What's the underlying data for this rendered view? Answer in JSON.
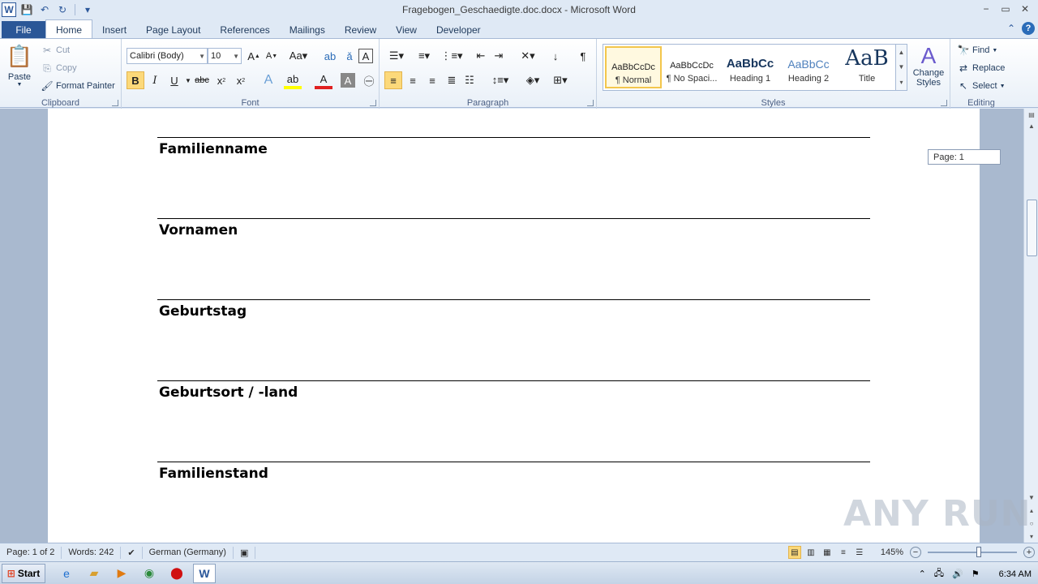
{
  "window": {
    "title": "Fragebogen_Geschaedigte.doc.docx - Microsoft Word",
    "controls": [
      "−",
      "▭",
      "✕"
    ]
  },
  "qat": {
    "app_icon": "W",
    "save": "💾",
    "undo": "↶",
    "redo": "↻",
    "customize": "▾"
  },
  "tabs": [
    "File",
    "Home",
    "Insert",
    "Page Layout",
    "References",
    "Mailings",
    "Review",
    "View",
    "Developer"
  ],
  "ribbon": {
    "clipboard": {
      "label": "Clipboard",
      "paste": "Paste",
      "cut": "Cut",
      "copy": "Copy",
      "format_painter": "Format Painter"
    },
    "font": {
      "label": "Font",
      "font_name": "Calibri (Body)",
      "font_size": "10"
    },
    "paragraph": {
      "label": "Paragraph"
    },
    "styles": {
      "label": "Styles",
      "items": [
        {
          "sample": "AaBbCcDc",
          "name": "¶ Normal"
        },
        {
          "sample": "AaBbCcDc",
          "name": "¶ No Spaci..."
        },
        {
          "sample": "AaBbCc",
          "name": "Heading 1"
        },
        {
          "sample": "AaBbCc",
          "name": "Heading 2"
        },
        {
          "sample": "AaB",
          "name": "Title"
        }
      ],
      "change_styles": "Change Styles"
    },
    "editing": {
      "label": "Editing",
      "find": "Find",
      "replace": "Replace",
      "select": "Select"
    }
  },
  "document": {
    "fields": [
      "Familienname",
      "Vornamen",
      "Geburtstag",
      "Geburtsort  / -land",
      "Familienstand"
    ],
    "page_tooltip": "Page: 1"
  },
  "statusbar": {
    "page": "Page: 1 of 2",
    "words": "Words: 242",
    "language": "German (Germany)",
    "zoom": "145%"
  },
  "taskbar": {
    "start": "Start",
    "time": "6:34 AM"
  },
  "watermark": "ANY RUN"
}
